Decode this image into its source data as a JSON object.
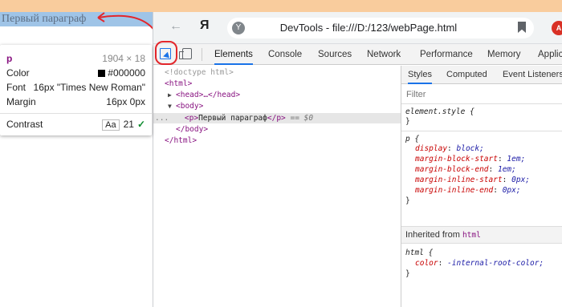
{
  "page": {
    "paragraph_text": "Первый параграф"
  },
  "tooltip": {
    "tag": "p",
    "size": "1904 × 18",
    "color_label": "Color",
    "color_value": "#000000",
    "font_label": "Font",
    "font_value": "16px \"Times New Roman\"",
    "margin_label": "Margin",
    "margin_value": "16px 0px",
    "contrast_label": "Contrast",
    "contrast_aa": "Aa",
    "contrast_value": "21"
  },
  "browser": {
    "back_glyph": "←",
    "ya_glyph": "Я",
    "site_glyph": "Y",
    "title": "DevTools - file:///D:/123/webPage.html",
    "ext_glyph": "A"
  },
  "devtools_tabs": [
    "Elements",
    "Console",
    "Sources",
    "Network",
    "Performance",
    "Memory",
    "Applic"
  ],
  "elements": {
    "doctype": "<!doctype html>",
    "html_open": "<html>",
    "head_collapsed": "<head>…</head>",
    "body_open": "<body>",
    "p_open": "<p>",
    "p_text": "Первый параграф",
    "p_close": "</p>",
    "eq_marker": "== $0",
    "dots": "...",
    "body_close": "</body>",
    "html_close": "</html>"
  },
  "styles": {
    "tabs": [
      "Styles",
      "Computed",
      "Event Listeners"
    ],
    "filter_placeholder": "Filter",
    "element_style_selector": "element.style {",
    "close_brace": "}",
    "p_selector": "p {",
    "p_props": [
      {
        "name": "display",
        "value": "block;"
      },
      {
        "name": "margin-block-start",
        "value": "1em;"
      },
      {
        "name": "margin-block-end",
        "value": "1em;"
      },
      {
        "name": "margin-inline-start",
        "value": "0px;"
      },
      {
        "name": "margin-inline-end",
        "value": "0px;"
      }
    ],
    "inherited_label": "Inherited from",
    "inherited_tag": "html",
    "html_selector": "html {",
    "html_props": [
      {
        "name": "color",
        "value": "-internal-root-color;"
      }
    ]
  },
  "colors": {
    "accent": "#1a73e8",
    "annotation_red": "#e3262b",
    "page_highlight": "#f9cc9d",
    "paragraph_highlight": "#9fc4e7"
  }
}
